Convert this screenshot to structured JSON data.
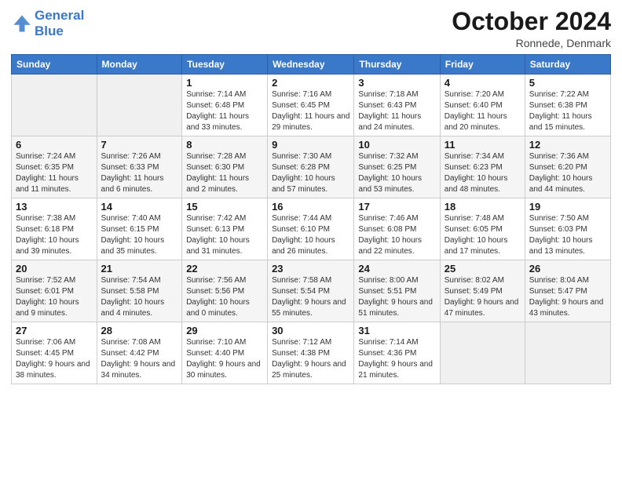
{
  "header": {
    "logo_line1": "General",
    "logo_line2": "Blue",
    "month_title": "October 2024",
    "location": "Ronnede, Denmark"
  },
  "weekdays": [
    "Sunday",
    "Monday",
    "Tuesday",
    "Wednesday",
    "Thursday",
    "Friday",
    "Saturday"
  ],
  "weeks": [
    [
      {
        "day": "",
        "info": ""
      },
      {
        "day": "",
        "info": ""
      },
      {
        "day": "1",
        "info": "Sunrise: 7:14 AM\nSunset: 6:48 PM\nDaylight: 11 hours and 33 minutes."
      },
      {
        "day": "2",
        "info": "Sunrise: 7:16 AM\nSunset: 6:45 PM\nDaylight: 11 hours and 29 minutes."
      },
      {
        "day": "3",
        "info": "Sunrise: 7:18 AM\nSunset: 6:43 PM\nDaylight: 11 hours and 24 minutes."
      },
      {
        "day": "4",
        "info": "Sunrise: 7:20 AM\nSunset: 6:40 PM\nDaylight: 11 hours and 20 minutes."
      },
      {
        "day": "5",
        "info": "Sunrise: 7:22 AM\nSunset: 6:38 PM\nDaylight: 11 hours and 15 minutes."
      }
    ],
    [
      {
        "day": "6",
        "info": "Sunrise: 7:24 AM\nSunset: 6:35 PM\nDaylight: 11 hours and 11 minutes."
      },
      {
        "day": "7",
        "info": "Sunrise: 7:26 AM\nSunset: 6:33 PM\nDaylight: 11 hours and 6 minutes."
      },
      {
        "day": "8",
        "info": "Sunrise: 7:28 AM\nSunset: 6:30 PM\nDaylight: 11 hours and 2 minutes."
      },
      {
        "day": "9",
        "info": "Sunrise: 7:30 AM\nSunset: 6:28 PM\nDaylight: 10 hours and 57 minutes."
      },
      {
        "day": "10",
        "info": "Sunrise: 7:32 AM\nSunset: 6:25 PM\nDaylight: 10 hours and 53 minutes."
      },
      {
        "day": "11",
        "info": "Sunrise: 7:34 AM\nSunset: 6:23 PM\nDaylight: 10 hours and 48 minutes."
      },
      {
        "day": "12",
        "info": "Sunrise: 7:36 AM\nSunset: 6:20 PM\nDaylight: 10 hours and 44 minutes."
      }
    ],
    [
      {
        "day": "13",
        "info": "Sunrise: 7:38 AM\nSunset: 6:18 PM\nDaylight: 10 hours and 39 minutes."
      },
      {
        "day": "14",
        "info": "Sunrise: 7:40 AM\nSunset: 6:15 PM\nDaylight: 10 hours and 35 minutes."
      },
      {
        "day": "15",
        "info": "Sunrise: 7:42 AM\nSunset: 6:13 PM\nDaylight: 10 hours and 31 minutes."
      },
      {
        "day": "16",
        "info": "Sunrise: 7:44 AM\nSunset: 6:10 PM\nDaylight: 10 hours and 26 minutes."
      },
      {
        "day": "17",
        "info": "Sunrise: 7:46 AM\nSunset: 6:08 PM\nDaylight: 10 hours and 22 minutes."
      },
      {
        "day": "18",
        "info": "Sunrise: 7:48 AM\nSunset: 6:05 PM\nDaylight: 10 hours and 17 minutes."
      },
      {
        "day": "19",
        "info": "Sunrise: 7:50 AM\nSunset: 6:03 PM\nDaylight: 10 hours and 13 minutes."
      }
    ],
    [
      {
        "day": "20",
        "info": "Sunrise: 7:52 AM\nSunset: 6:01 PM\nDaylight: 10 hours and 9 minutes."
      },
      {
        "day": "21",
        "info": "Sunrise: 7:54 AM\nSunset: 5:58 PM\nDaylight: 10 hours and 4 minutes."
      },
      {
        "day": "22",
        "info": "Sunrise: 7:56 AM\nSunset: 5:56 PM\nDaylight: 10 hours and 0 minutes."
      },
      {
        "day": "23",
        "info": "Sunrise: 7:58 AM\nSunset: 5:54 PM\nDaylight: 9 hours and 55 minutes."
      },
      {
        "day": "24",
        "info": "Sunrise: 8:00 AM\nSunset: 5:51 PM\nDaylight: 9 hours and 51 minutes."
      },
      {
        "day": "25",
        "info": "Sunrise: 8:02 AM\nSunset: 5:49 PM\nDaylight: 9 hours and 47 minutes."
      },
      {
        "day": "26",
        "info": "Sunrise: 8:04 AM\nSunset: 5:47 PM\nDaylight: 9 hours and 43 minutes."
      }
    ],
    [
      {
        "day": "27",
        "info": "Sunrise: 7:06 AM\nSunset: 4:45 PM\nDaylight: 9 hours and 38 minutes."
      },
      {
        "day": "28",
        "info": "Sunrise: 7:08 AM\nSunset: 4:42 PM\nDaylight: 9 hours and 34 minutes."
      },
      {
        "day": "29",
        "info": "Sunrise: 7:10 AM\nSunset: 4:40 PM\nDaylight: 9 hours and 30 minutes."
      },
      {
        "day": "30",
        "info": "Sunrise: 7:12 AM\nSunset: 4:38 PM\nDaylight: 9 hours and 25 minutes."
      },
      {
        "day": "31",
        "info": "Sunrise: 7:14 AM\nSunset: 4:36 PM\nDaylight: 9 hours and 21 minutes."
      },
      {
        "day": "",
        "info": ""
      },
      {
        "day": "",
        "info": ""
      }
    ]
  ]
}
